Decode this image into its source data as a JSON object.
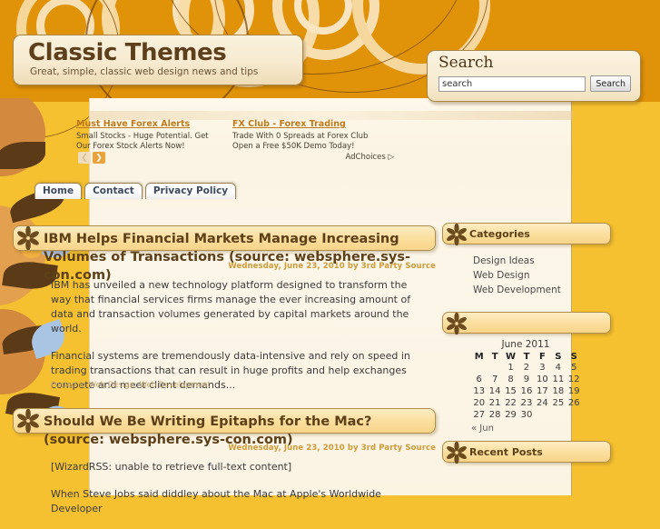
{
  "site": {
    "title": "Classic Themes",
    "tagline": "Great, simple, classic web design news and tips"
  },
  "search": {
    "heading": "Search",
    "value": "search",
    "placeholder": "search",
    "button_label": "Search"
  },
  "ads": {
    "items": [
      {
        "title": "Must Have Forex Alerts",
        "description": "Small Stocks - Huge Potential. Get Our Forex Stock Alerts Now!"
      },
      {
        "title": "FX Club - Forex Trading",
        "description": "Trade With 0 Spreads at Forex Club Open a Free $50K Demo Today!"
      }
    ],
    "prev_label": "❮",
    "next_label": "❯",
    "adchoices_label": "AdChoices ▷"
  },
  "nav": {
    "tabs": [
      {
        "label": "Home"
      },
      {
        "label": "Contact"
      },
      {
        "label": "Privacy Policy"
      }
    ]
  },
  "posts": [
    {
      "title": "IBM Helps Financial Markets Manage Increasing Volumes of Transactions (source: websphere.sys-con.com)",
      "meta": "Wednesday, June 23, 2010 by 3rd Party Source",
      "paragraph1": "IBM has unveiled a new technology platform designed to transform the way that financial services firms manage the ever increasing amount of data and transaction volumes generated by capital markets around the world.",
      "paragraph2": "Financial systems are tremendously data-intensive and rely on speed in trading transactions that can result in huge profits and help exchanges compete and meet client demands...",
      "posted_in_label": "Posted in ",
      "category1": "Web Design",
      "separator": ", ",
      "category2": "Web Development"
    },
    {
      "title": "Should We Be Writing Epitaphs for the Mac? (source: websphere.sys-con.com)",
      "meta": "Wednesday, June 23, 2010 by 3rd Party Source",
      "paragraph1": "[WizardRSS: unable to retrieve full-text content]",
      "paragraph2": "When Steve Jobs said diddley about the Mac at Apple's Worldwide Developer"
    }
  ],
  "sidebar": {
    "categories": {
      "heading": "Categories",
      "items": [
        {
          "label": "Design Ideas"
        },
        {
          "label": "Web Design"
        },
        {
          "label": "Web Development"
        }
      ]
    },
    "calendar": {
      "heading": "",
      "caption": "June 2011",
      "day_headers": [
        "M",
        "T",
        "W",
        "T",
        "F",
        "S",
        "S"
      ],
      "weeks": [
        [
          "",
          "",
          "1",
          "2",
          "3",
          "4",
          "5"
        ],
        [
          "6",
          "7",
          "8",
          "9",
          "10",
          "11",
          "12"
        ],
        [
          "13",
          "14",
          "15",
          "16",
          "17",
          "18",
          "19"
        ],
        [
          "20",
          "21",
          "22",
          "23",
          "24",
          "25",
          "26"
        ],
        [
          "27",
          "28",
          "29",
          "30",
          "",
          "",
          ""
        ]
      ],
      "prev_link": "« Jun"
    },
    "recent_posts": {
      "heading": "Recent Posts"
    }
  },
  "colors": {
    "header_orange": "#e09208",
    "gold": "#f6c130",
    "sheet_cream": "#fbf4e4",
    "widget_gold": "#fbdf9f",
    "title_brown": "#5d4018",
    "meta_tan": "#cf9b38",
    "ad_link": "#c07a1b"
  }
}
